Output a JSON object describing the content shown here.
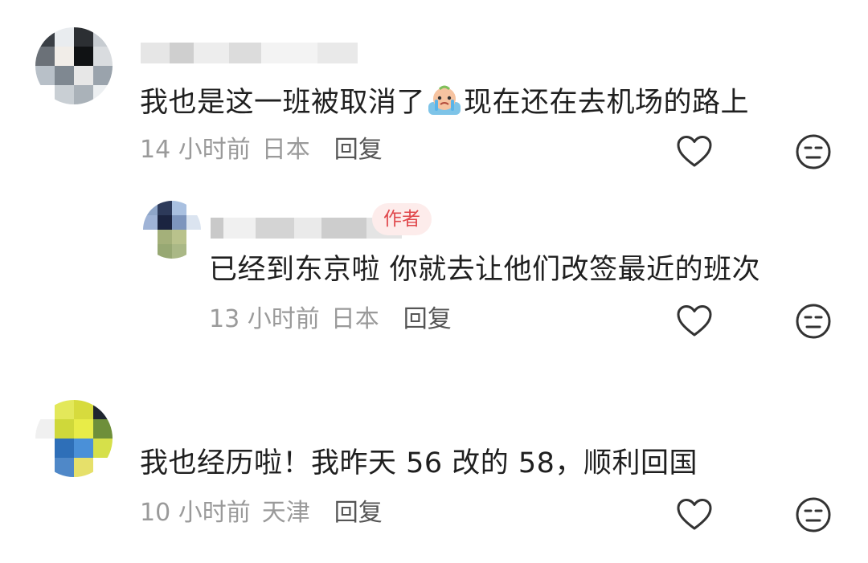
{
  "comments": [
    {
      "text_before": "我也是这一班被取消了",
      "emoji": "crying-emoji",
      "text_after": "现在还在去机场的路上",
      "time": "14 小时前",
      "location": "日本",
      "reply_label": "回复"
    },
    {
      "author_badge": "作者",
      "text": "已经到东京啦 你就去让他们改签最近的班次",
      "time": "13 小时前",
      "location": "日本",
      "reply_label": "回复"
    },
    {
      "text": "我也经历啦！我昨天 56 改的 58，顺利回国",
      "time": "10 小时前",
      "location": "天津",
      "reply_label": "回复"
    }
  ],
  "icons": {
    "like": "heart-icon",
    "dislike": "neutral-face-icon"
  },
  "colors": {
    "badge_text": "#e0474b",
    "badge_bg": "#fdeceb",
    "meta": "#9a9a9a"
  }
}
